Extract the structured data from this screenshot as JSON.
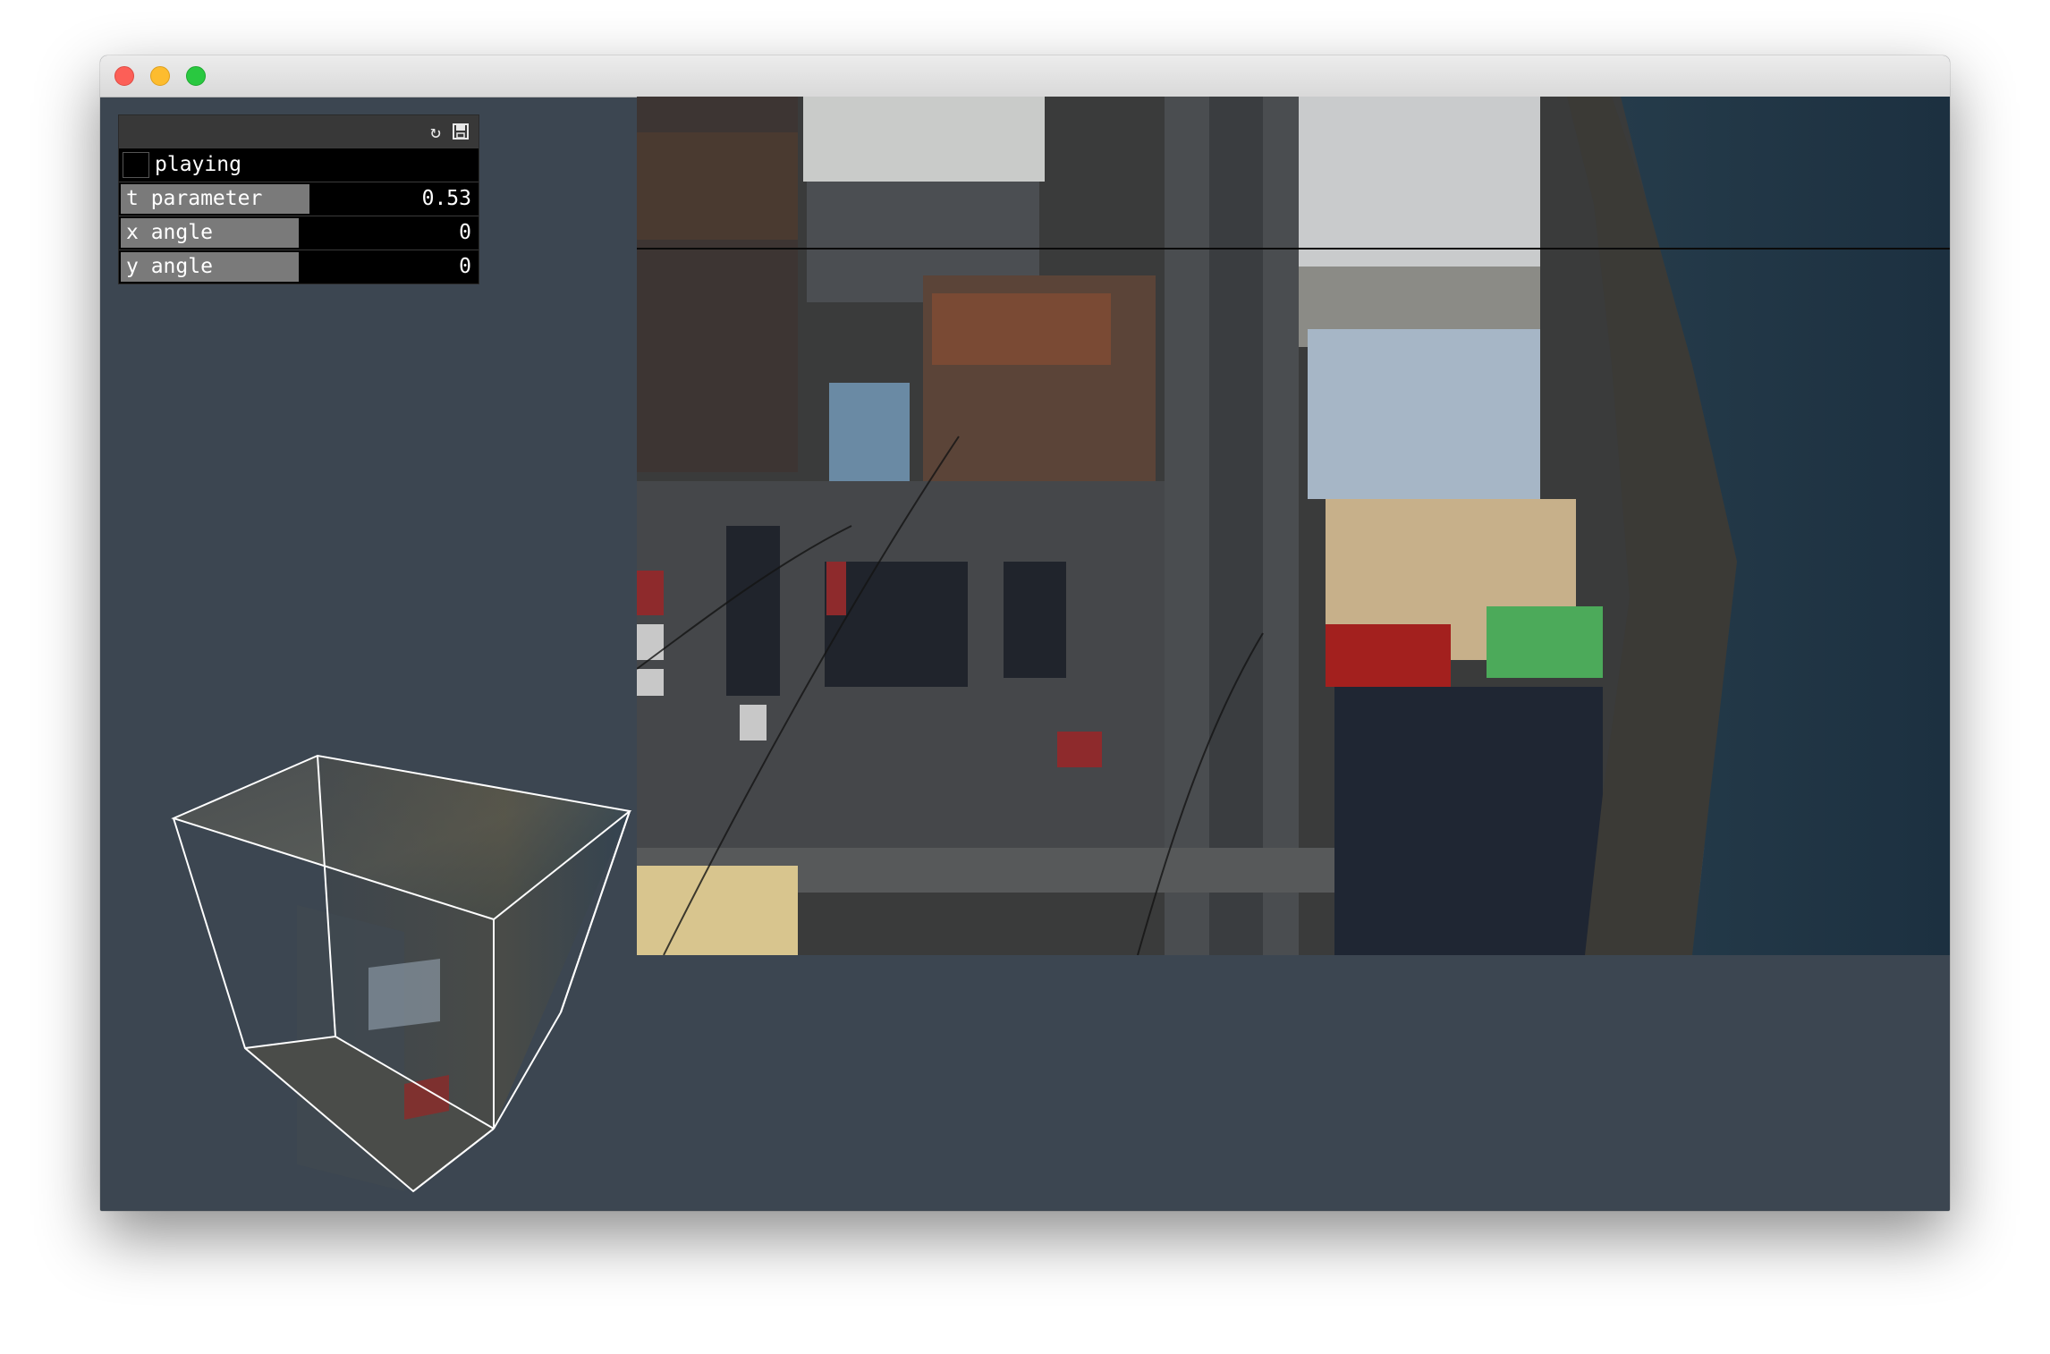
{
  "window": {
    "buttons": [
      "close",
      "minimize",
      "maximize"
    ]
  },
  "gui": {
    "header_icons": [
      "reload-icon",
      "save-icon"
    ],
    "playing": {
      "label": "playing",
      "checked": false
    },
    "t_parameter": {
      "label": "t parameter",
      "value": "0.53",
      "fill": 0.53
    },
    "x_angle": {
      "label": "x angle",
      "value": "0",
      "fill": 0.5
    },
    "y_angle": {
      "label": "y angle",
      "value": "0",
      "fill": 0.5
    }
  },
  "colors": {
    "background": "#3c4651",
    "panel": "#111111",
    "slider_fill": "#7a7a7a",
    "water": "#1e3444"
  }
}
